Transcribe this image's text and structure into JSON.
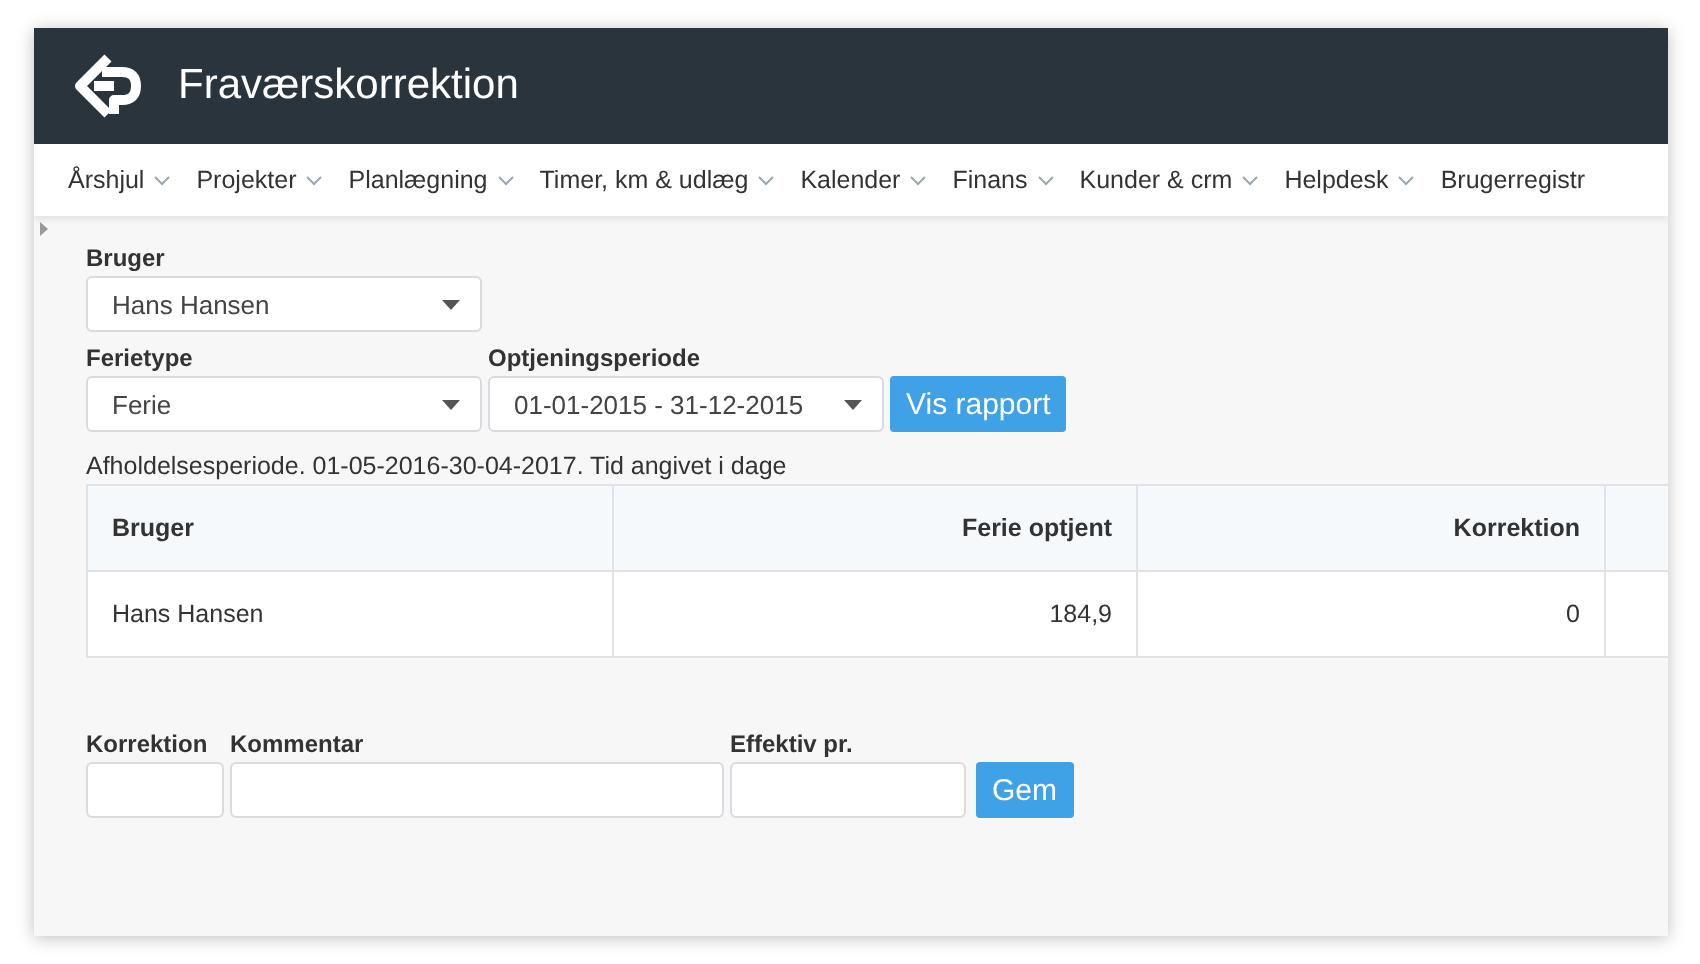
{
  "window": {
    "title": "Fraværskorrektion"
  },
  "nav": [
    {
      "label": "Årshjul",
      "caret": true
    },
    {
      "label": "Projekter",
      "caret": true
    },
    {
      "label": "Planlægning",
      "caret": true
    },
    {
      "label": "Timer, km & udlæg",
      "caret": true
    },
    {
      "label": "Kalender",
      "caret": true
    },
    {
      "label": "Finans",
      "caret": true
    },
    {
      "label": "Kunder & crm",
      "caret": true
    },
    {
      "label": "Helpdesk",
      "caret": true
    },
    {
      "label": "Brugerregistr",
      "caret": false
    }
  ],
  "filters": {
    "user": {
      "label": "Bruger",
      "value": "Hans Hansen"
    },
    "type": {
      "label": "Ferietype",
      "value": "Ferie"
    },
    "period": {
      "label": "Optjeningsperiode",
      "value": "01-01-2015 - 31-12-2015"
    },
    "button": "Vis rapport"
  },
  "note": "Afholdelsesperiode. 01-05-2016-30-04-2017. Tid angivet i dage",
  "table": {
    "columns": [
      "Bruger",
      "Ferie optjent",
      "Korrektion"
    ],
    "rows": [
      [
        "Hans Hansen",
        "184,9",
        "0"
      ]
    ]
  },
  "correction_form": {
    "fields": [
      {
        "label": "Korrektion"
      },
      {
        "label": "Kommentar"
      },
      {
        "label": "Effektiv pr."
      }
    ],
    "button": "Gem"
  }
}
